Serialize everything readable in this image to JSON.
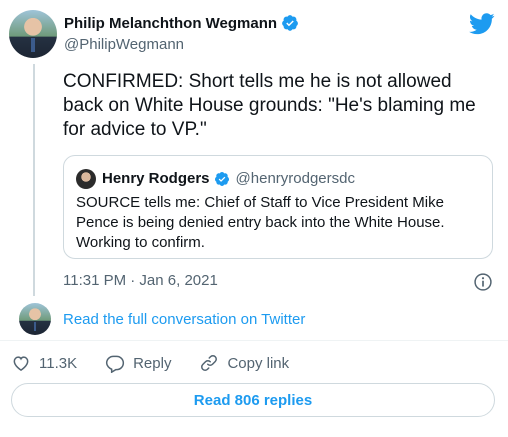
{
  "author": {
    "name": "Philip Melanchthon Wegmann",
    "handle": "@PhilipWegmann"
  },
  "tweet": {
    "text": "CONFIRMED: Short tells me he is not allowed back on White House grounds: \"He's blaming me for advice to VP.\"",
    "timestamp": "11:31 PM · Jan 6, 2021"
  },
  "quoted": {
    "name": "Henry Rodgers",
    "handle": "@henryrodgersdc",
    "text": "SOURCE tells me: Chief of Staff to Vice President Mike Pence is being denied entry back into the White House. Working to confirm."
  },
  "links": {
    "full_conversation": "Read the full conversation on Twitter"
  },
  "actions": {
    "likes": "11.3K",
    "reply": "Reply",
    "copy_link": "Copy link"
  },
  "replies_button": "Read 806 replies",
  "colors": {
    "brand_blue": "#1d9bf0",
    "text_secondary": "#536471",
    "border": "#cfd9de"
  },
  "icons": [
    "twitter-bird-icon",
    "verified-badge-icon",
    "info-icon",
    "heart-icon",
    "reply-icon",
    "link-icon"
  ]
}
